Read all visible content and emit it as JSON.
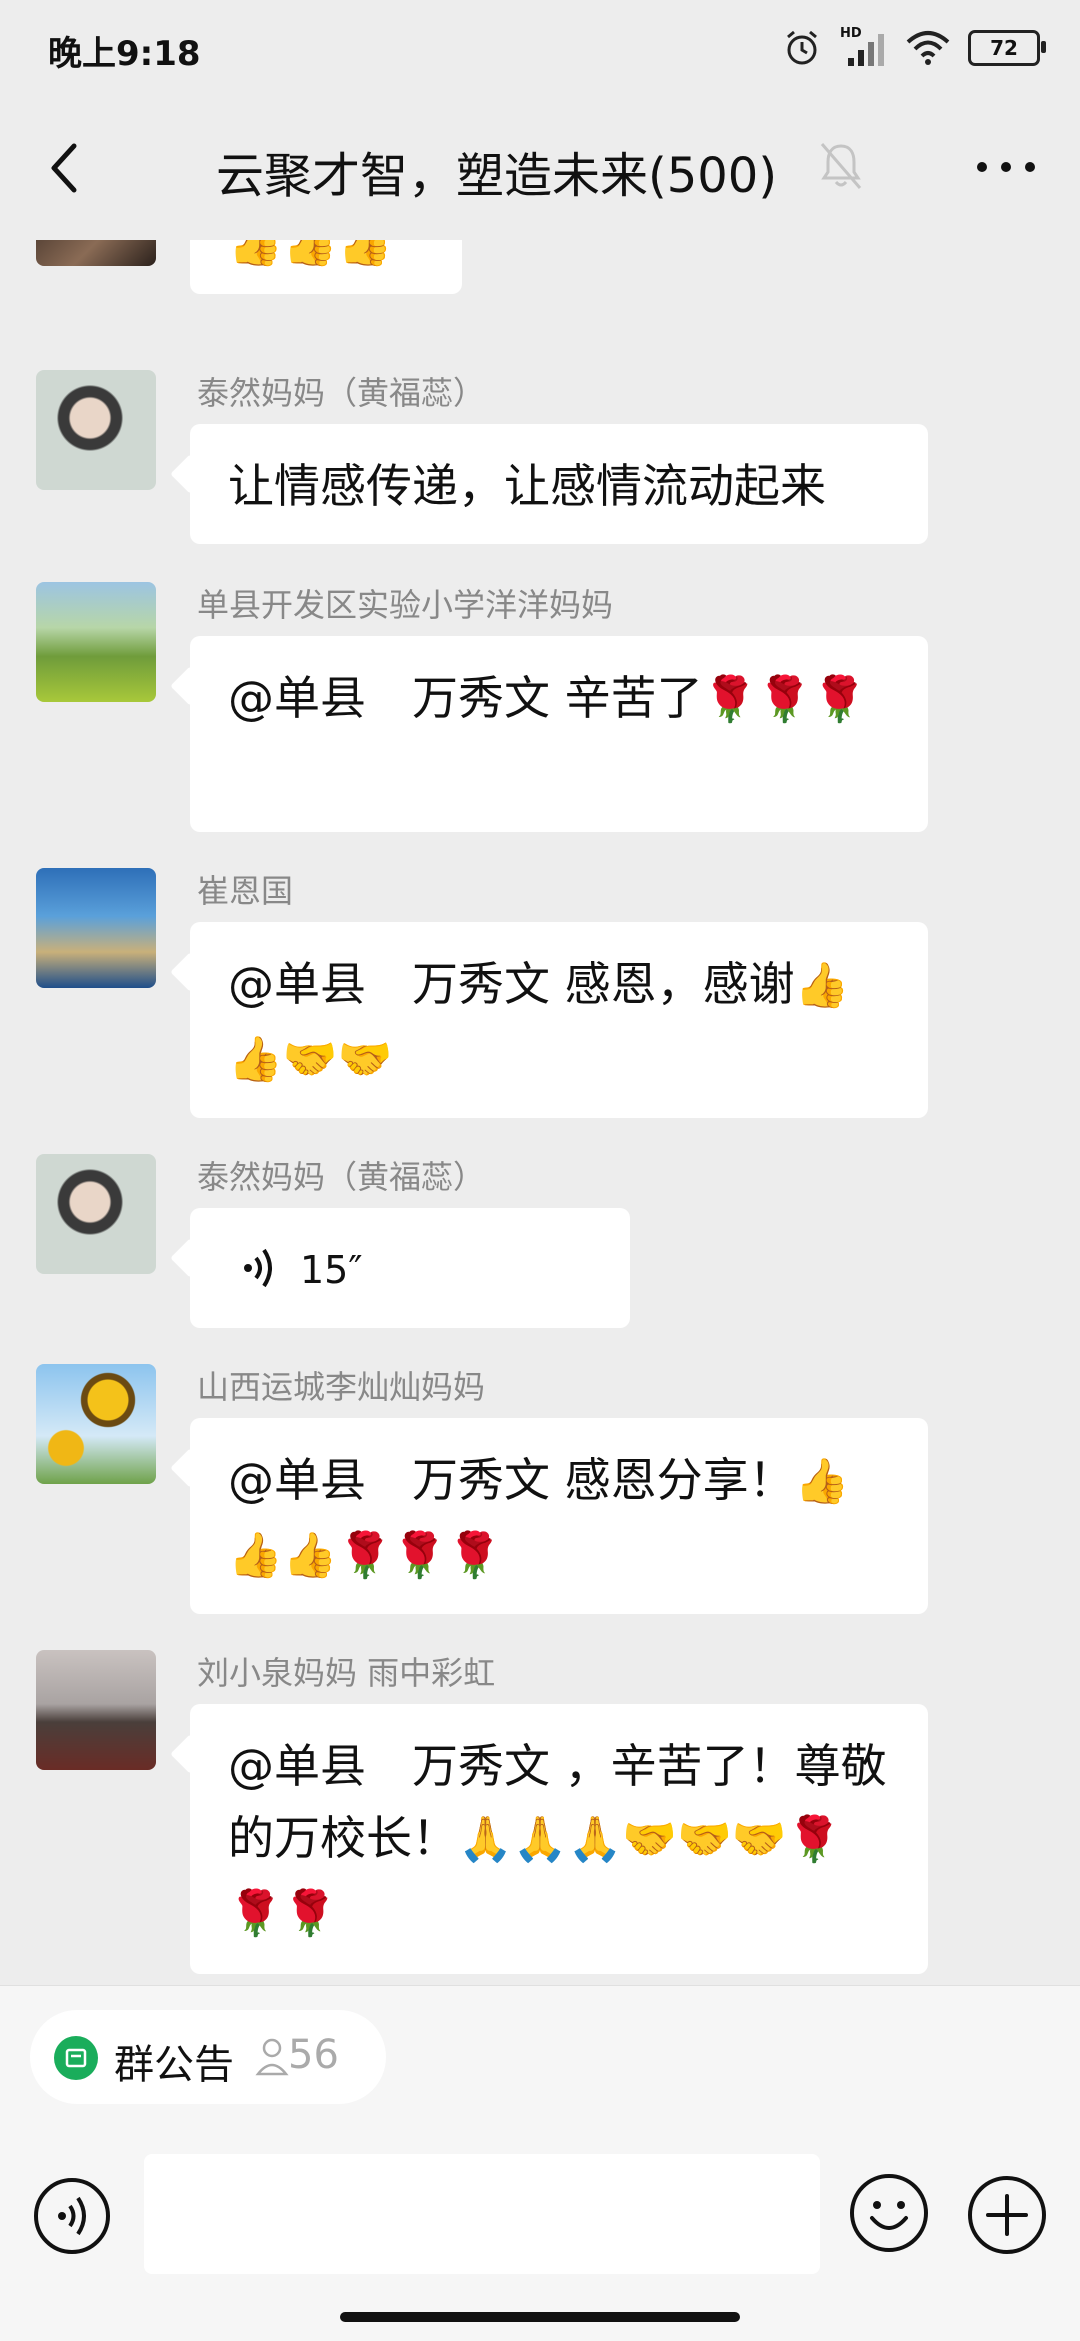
{
  "status_bar": {
    "time": "晚上9:18",
    "network": "HD",
    "battery": "72"
  },
  "header": {
    "title": "云聚才智，塑造未来(500)"
  },
  "messages": [
    {
      "sender": "",
      "text": "",
      "emoji": "👍👍👍"
    },
    {
      "sender": "泰然妈妈（黄福蕊）",
      "text": "让情感传递，让感情流动起来",
      "emoji": ""
    },
    {
      "sender": "单县开发区实验小学洋洋妈妈",
      "text": "@单县　万秀文  辛苦了",
      "emoji": "🌹🌹🌹"
    },
    {
      "sender": "崔恩国",
      "text": "@单县　万秀文  感恩，感谢",
      "emoji": "👍👍🤝🤝"
    },
    {
      "sender": "泰然妈妈（黄福蕊）",
      "text": "15″",
      "emoji": ""
    },
    {
      "sender": "山西运城李灿灿妈妈",
      "text": "@单县　万秀文  感恩分享！",
      "emoji": "👍👍👍🌹🌹🌹"
    },
    {
      "sender": "刘小泉妈妈  雨中彩虹",
      "text": "@单县　万秀文 ，辛苦了！尊敬的万校长！",
      "emoji": "🙏🙏🙏🤝🤝🤝🌹🌹🌹"
    }
  ],
  "bottom": {
    "notice_label": "群公告",
    "member_count": "56"
  }
}
